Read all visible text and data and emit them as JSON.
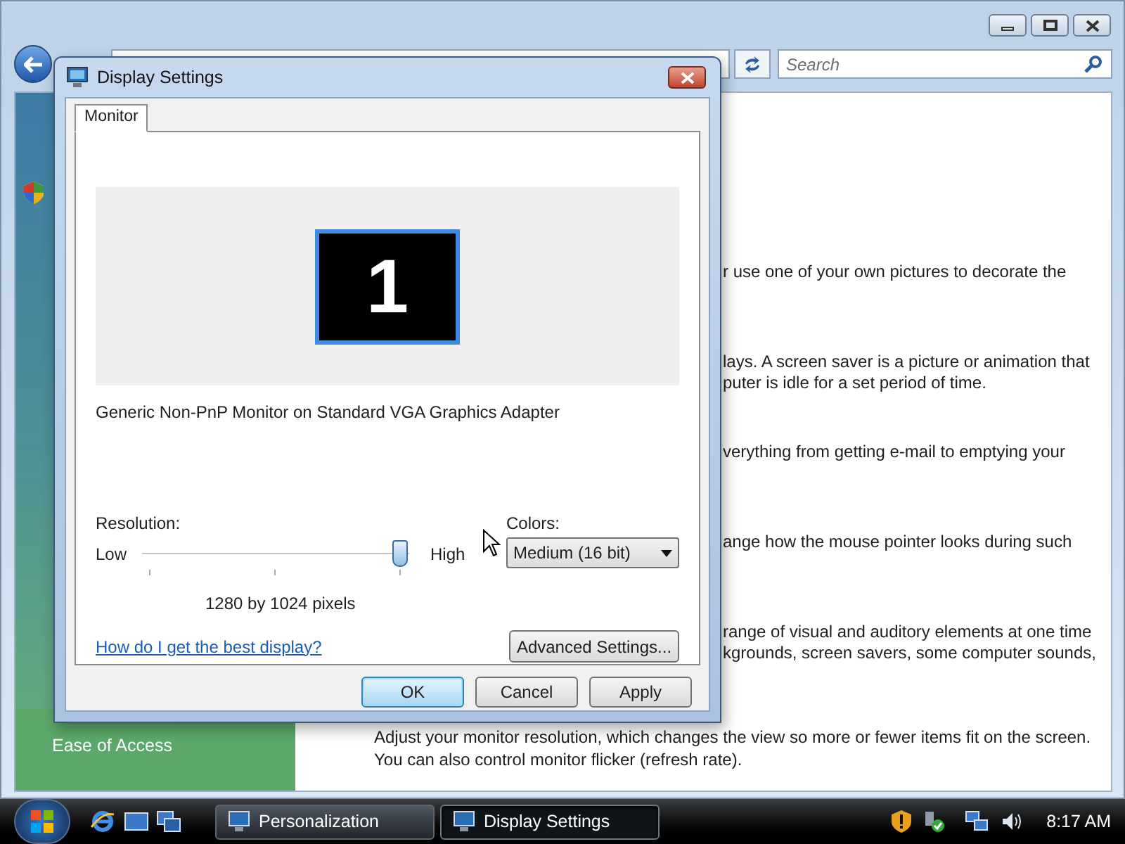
{
  "explorer": {
    "search": {
      "placeholder": "Search"
    },
    "sidebar": {
      "items": [
        {
          "label": "Ease of Access"
        }
      ]
    },
    "content": {
      "fragments": [
        [
          "r use one of your own pictures to decorate the"
        ],
        [
          "lays. A screen saver is a picture or animation that",
          "puter is idle for a set period of time."
        ],
        [
          "verything from getting e-mail to emptying your"
        ],
        [
          "ange how the mouse pointer looks during such"
        ],
        [
          "range of visual and auditory elements at one time",
          "kgrounds, screen savers, some computer sounds,"
        ]
      ],
      "paragraph": [
        "Adjust your monitor resolution, which changes the view so more or fewer items fit on the screen.",
        "You can also control monitor flicker (refresh rate)."
      ]
    }
  },
  "dialog": {
    "title": "Display Settings",
    "tabs": [
      {
        "label": "Monitor",
        "selected": true
      }
    ],
    "monitor_number": "1",
    "monitor_description": "Generic Non-PnP Monitor on Standard VGA Graphics Adapter",
    "resolution": {
      "label": "Resolution:",
      "low_label": "Low",
      "high_label": "High",
      "level": 1,
      "reading": "1280 by 1024 pixels"
    },
    "colors": {
      "label": "Colors:",
      "value": "Medium (16 bit)"
    },
    "help_link": "How do I get the best display?",
    "advanced_button": "Advanced Settings...",
    "buttons": [
      {
        "label": "OK",
        "default": true
      },
      {
        "label": "Cancel",
        "default": false
      },
      {
        "label": "Apply",
        "default": false
      }
    ]
  },
  "taskbar": {
    "tasks": [
      {
        "label": "Personalization",
        "selected": false
      },
      {
        "label": "Display Settings",
        "selected": true
      }
    ],
    "clock": "8:17 AM"
  }
}
